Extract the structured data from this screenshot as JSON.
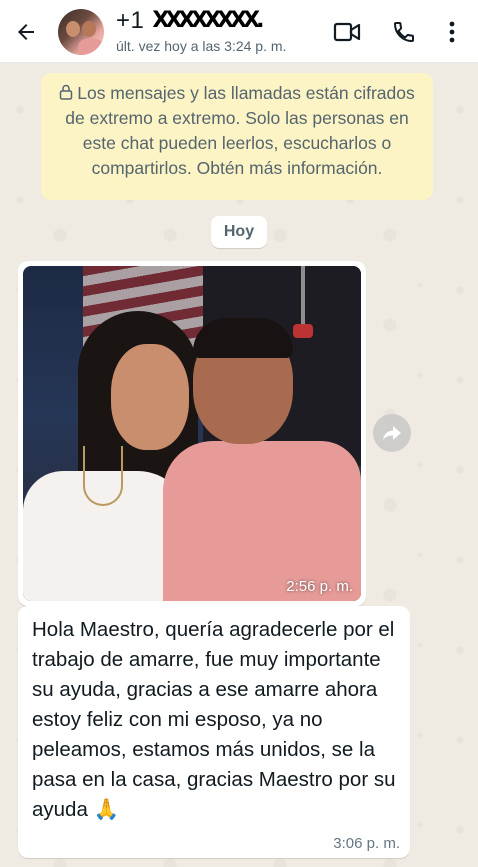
{
  "header": {
    "contact_name": "+1",
    "redaction": "XXXXXXXX.",
    "last_seen": "últ. vez hoy a las 3:24 p. m.",
    "icons": {
      "back": "arrow-left-icon",
      "video": "video-camera-icon",
      "call": "phone-icon",
      "menu": "more-vertical-icon"
    }
  },
  "encryption_notice": {
    "text": "Los mensajes y las llamadas están cifrados de extremo a extremo. Solo las personas en este chat pueden leerlos, escucharlos o compartirlos. Obtén más información.",
    "icon": "lock-icon"
  },
  "date_chip": "Hoy",
  "messages": [
    {
      "type": "image",
      "time": "2:56 p. m."
    },
    {
      "type": "text",
      "text": "Hola Maestro, quería agradecerle por el trabajo de amarre, fue muy importante su ayuda, gracias a ese amarre ahora estoy feliz con mi esposo, ya no peleamos, estamos más unidos, se la pasa en la casa, gracias Maestro por su ayuda 🙏",
      "time": "3:06 p. m."
    }
  ],
  "forward_icon": "forward-icon",
  "colors": {
    "chat_background": "#efeae2",
    "notice_background": "#fdf4c5",
    "bubble_background": "#ffffff",
    "secondary_text": "#54656f"
  }
}
